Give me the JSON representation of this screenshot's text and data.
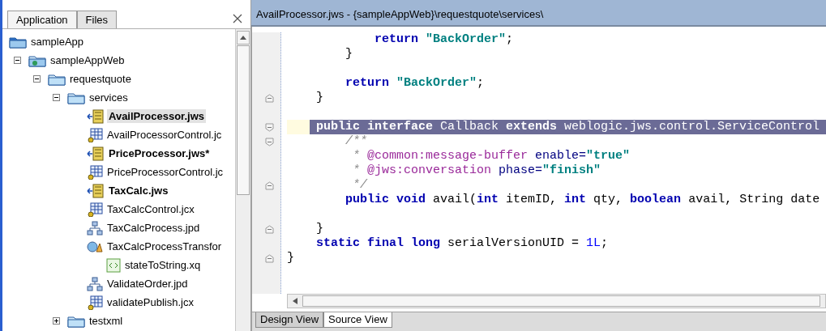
{
  "sidebar": {
    "tabs": [
      {
        "label": "Application",
        "selected": true
      },
      {
        "label": "Files",
        "selected": false
      }
    ],
    "tree": [
      {
        "label": "sampleApp",
        "kind": "app",
        "bold": false,
        "selected": false,
        "children": [
          {
            "label": "sampleAppWeb",
            "kind": "webapp",
            "bold": false,
            "selected": false,
            "expanded": true,
            "children": [
              {
                "label": "requestquote",
                "kind": "folder",
                "bold": false,
                "selected": false,
                "expanded": true,
                "children": [
                  {
                    "label": "services",
                    "kind": "folder",
                    "bold": false,
                    "selected": false,
                    "expanded": true,
                    "children": [
                      {
                        "label": "AvailProcessor.jws",
                        "kind": "service",
                        "bold": true,
                        "selected": true
                      },
                      {
                        "label": "AvailProcessorControl.jc",
                        "kind": "control",
                        "bold": false,
                        "selected": false
                      },
                      {
                        "label": "PriceProcessor.jws*",
                        "kind": "service",
                        "bold": true,
                        "selected": false
                      },
                      {
                        "label": "PriceProcessorControl.jc",
                        "kind": "control",
                        "bold": false,
                        "selected": false
                      },
                      {
                        "label": "TaxCalc.jws",
                        "kind": "service",
                        "bold": true,
                        "selected": false
                      },
                      {
                        "label": "TaxCalcControl.jcx",
                        "kind": "control",
                        "bold": false,
                        "selected": false
                      },
                      {
                        "label": "TaxCalcProcess.jpd",
                        "kind": "process",
                        "bold": false,
                        "selected": false
                      },
                      {
                        "label": "TaxCalcProcessTransfor",
                        "kind": "transform",
                        "bold": false,
                        "selected": false,
                        "children": [
                          {
                            "label": "stateToString.xq",
                            "kind": "xquery",
                            "bold": false,
                            "selected": false
                          }
                        ]
                      },
                      {
                        "label": "ValidateOrder.jpd",
                        "kind": "process",
                        "bold": false,
                        "selected": false
                      },
                      {
                        "label": "validatePublish.jcx",
                        "kind": "control",
                        "bold": false,
                        "selected": false
                      }
                    ]
                  },
                  {
                    "label": "testxml",
                    "kind": "folder",
                    "bold": false,
                    "selected": false,
                    "expanded": false
                  }
                ]
              }
            ]
          }
        ]
      }
    ]
  },
  "editor": {
    "title": "AvailProcessor.jws - {sampleAppWeb}\\requestquote\\services\\",
    "lines": [
      {
        "selected": false,
        "tokens": [
          {
            "kind": "keyword",
            "text": "            return "
          },
          {
            "kind": "string",
            "text": "\"BackOrder\""
          },
          {
            "kind": "plain",
            "text": ";"
          }
        ]
      },
      {
        "selected": false,
        "tokens": [
          {
            "kind": "plain",
            "text": "        }"
          }
        ]
      },
      {
        "selected": false
      },
      {
        "selected": false,
        "tokens": [
          {
            "kind": "keyword",
            "text": "        return "
          },
          {
            "kind": "string",
            "text": "\"BackOrder\""
          },
          {
            "kind": "plain",
            "text": ";"
          }
        ]
      },
      {
        "selected": false,
        "fold_end": true,
        "tokens": [
          {
            "kind": "plain",
            "text": "    }"
          }
        ]
      },
      {
        "selected": false
      },
      {
        "selected": true,
        "fold_start": true,
        "tokens": [
          {
            "kind": "keyword",
            "text": "    public interface "
          },
          {
            "kind": "plain",
            "text": "Callback "
          },
          {
            "kind": "keyword",
            "text": "extends "
          },
          {
            "kind": "plain",
            "text": "weblogic.jws.control.ServiceControl"
          }
        ]
      },
      {
        "selected": false,
        "fold_start": true,
        "tokens": [
          {
            "kind": "comment",
            "text": "        /**"
          }
        ]
      },
      {
        "selected": false,
        "tokens": [
          {
            "kind": "comment",
            "text": "         * "
          },
          {
            "kind": "tag",
            "text": "@common:message-buffer "
          },
          {
            "kind": "attr",
            "text": "enable="
          },
          {
            "kind": "string",
            "text": "\"true\""
          }
        ]
      },
      {
        "selected": false,
        "tokens": [
          {
            "kind": "comment",
            "text": "         * "
          },
          {
            "kind": "tag",
            "text": "@jws:conversation "
          },
          {
            "kind": "attr",
            "text": "phase="
          },
          {
            "kind": "string",
            "text": "\"finish\""
          }
        ]
      },
      {
        "selected": false,
        "fold_end": true,
        "tokens": [
          {
            "kind": "comment",
            "text": "         */"
          }
        ]
      },
      {
        "selected": false,
        "tokens": [
          {
            "kind": "keyword",
            "text": "        public void "
          },
          {
            "kind": "plain",
            "text": "avail("
          },
          {
            "kind": "keyword",
            "text": "int "
          },
          {
            "kind": "plain",
            "text": "itemID, "
          },
          {
            "kind": "keyword",
            "text": "int "
          },
          {
            "kind": "plain",
            "text": "qty, "
          },
          {
            "kind": "keyword",
            "text": "boolean "
          },
          {
            "kind": "plain",
            "text": "avail, String date"
          }
        ]
      },
      {
        "selected": false
      },
      {
        "selected": false,
        "fold_end": true,
        "tokens": [
          {
            "kind": "plain",
            "text": "    }"
          }
        ]
      },
      {
        "selected": false,
        "tokens": [
          {
            "kind": "keyword",
            "text": "    static final long "
          },
          {
            "kind": "plain",
            "text": "serialVersionUID = "
          },
          {
            "kind": "number",
            "text": "1L"
          },
          {
            "kind": "plain",
            "text": ";"
          }
        ]
      },
      {
        "selected": false,
        "fold_end": true,
        "tokens": [
          {
            "kind": "plain",
            "text": "}"
          }
        ]
      }
    ],
    "view_tabs": [
      {
        "label": "Design View",
        "selected": false
      },
      {
        "label": "Source View",
        "selected": true
      }
    ]
  }
}
